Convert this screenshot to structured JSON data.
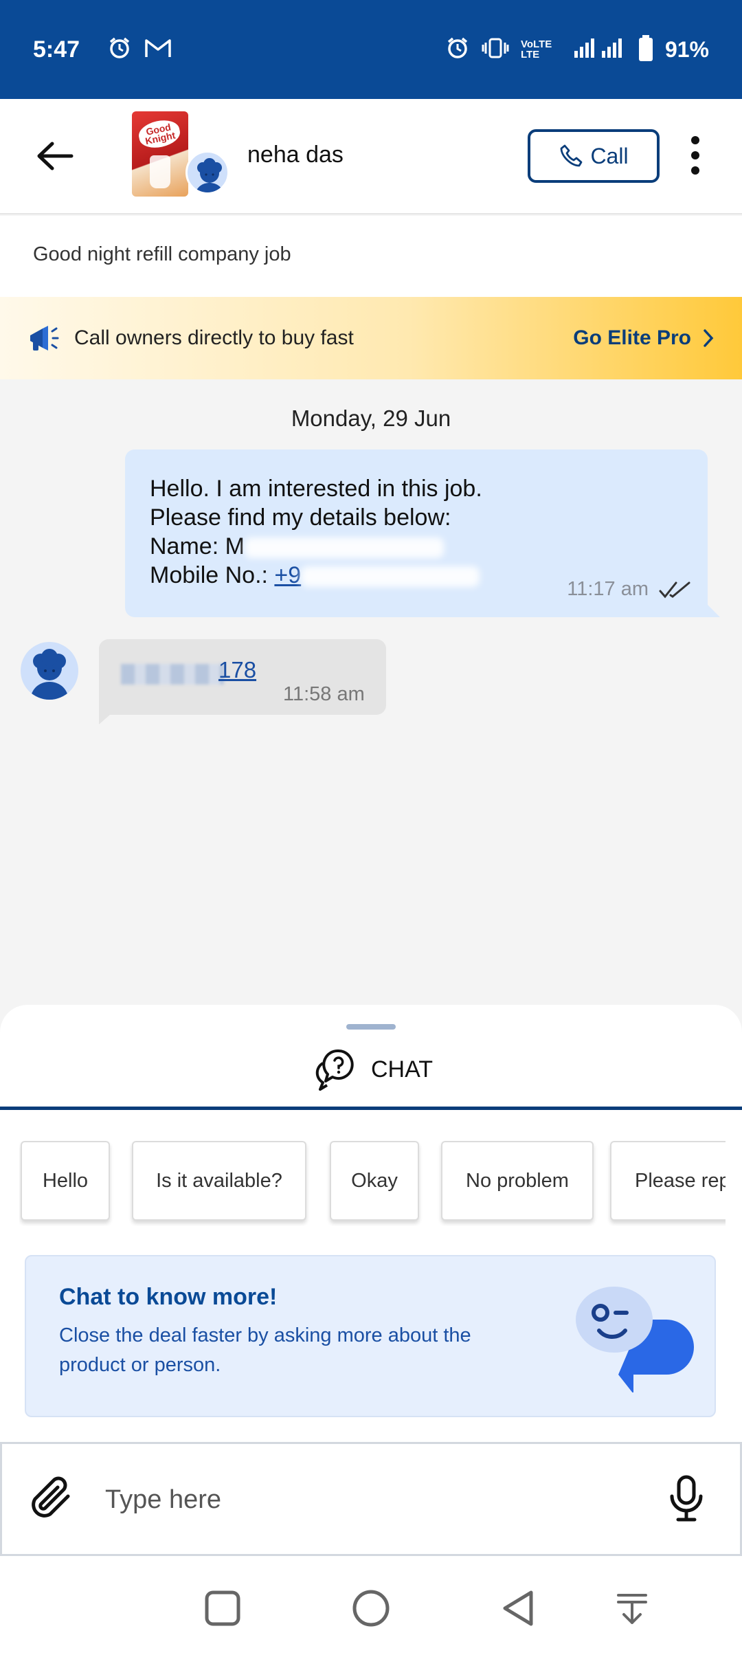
{
  "status_bar": {
    "time": "5:47",
    "battery": "91%",
    "network": "VoLTE LTE"
  },
  "header": {
    "contact_name": "neha das",
    "call_label": "Call",
    "product_logo_text": "Good Knight"
  },
  "listing": {
    "title": "Good night refill company job"
  },
  "promo": {
    "text": "Call owners directly to buy fast",
    "cta": "Go Elite Pro"
  },
  "chat": {
    "date": "Monday, 29 Jun",
    "outgoing": {
      "line1": "Hello. I am interested in this job.",
      "line2": "Please find my details below:",
      "name_label": "Name: M",
      "mobile_label": "Mobile No.: ",
      "mobile_value": "+9",
      "time": "11:17 am"
    },
    "incoming": {
      "visible_digits": "178",
      "time": "11:58 am"
    }
  },
  "sheet": {
    "tab_label": "CHAT",
    "quick_replies": [
      "Hello",
      "Is it available?",
      "Okay",
      "No problem",
      "Please rep"
    ],
    "info_heading": "Chat to know more!",
    "info_body": "Close the deal faster by asking more about the product or person."
  },
  "composer": {
    "placeholder": "Type here"
  },
  "colors": {
    "brand_blue": "#0a4a96",
    "accent": "#0a3d7a",
    "promo_yellow": "#ffc93a",
    "bubble_out": "#dbeafd",
    "bubble_in": "#e4e4e4"
  }
}
